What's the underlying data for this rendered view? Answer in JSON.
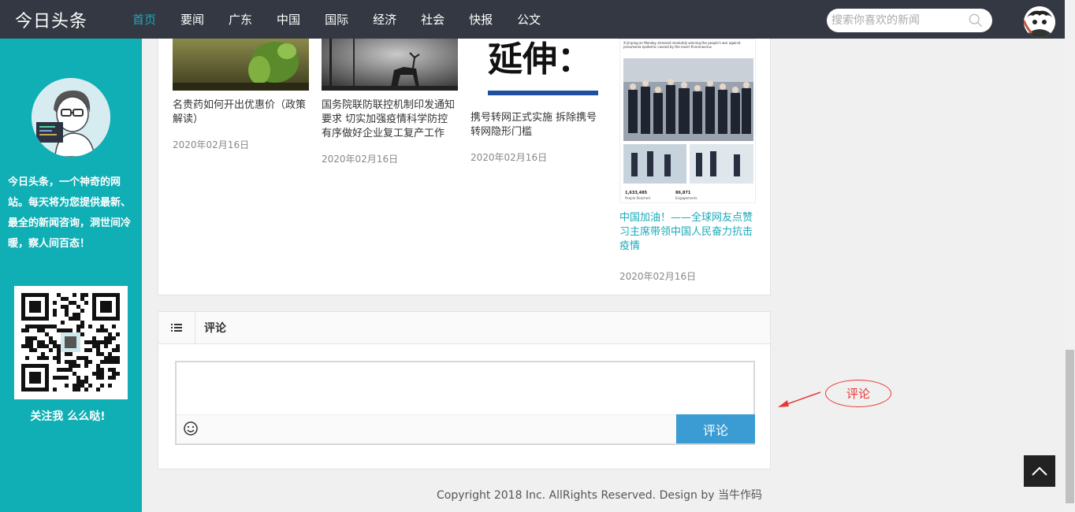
{
  "header": {
    "logo": "今日头条",
    "nav": [
      "首页",
      "要闻",
      "广东",
      "中国",
      "国际",
      "经济",
      "社会",
      "快报",
      "公文"
    ],
    "active_index": 0,
    "search_placeholder": "搜索你喜欢的新闻"
  },
  "sidebar": {
    "description": "今日头条，一个神奇的网站。每天将为您提供最新、最全的新闻咨询，洞世间冷暖，察人间百态！",
    "follow": "关注我 么么哒!"
  },
  "articles": [
    {
      "title": "名贵药如何开出优惠价（政策解读）",
      "date": "2020年02月16日"
    },
    {
      "title": "国务院联防联控机制印发通知要求 切实加强疫情科学防控 有序做好企业复工复产工作",
      "date": "2020年02月16日"
    },
    {
      "title": "携号转网正式实施 拆除携号转网隐形门槛",
      "date": "2020年02月16日",
      "image_text": "延伸："
    },
    {
      "title": "中国加油！——全球网友点赞习主席带领中国人民奋力抗击疫情",
      "date": "2020年02月16日",
      "image_caption": "Xi Jinping on Monday stressed resolutely winning the people's war against pneumonia epidemic caused by the novel #coronavirus",
      "stats": [
        {
          "value": "1,633,485",
          "label": "People Reached"
        },
        {
          "value": "86,871",
          "label": "Engagements"
        }
      ]
    }
  ],
  "comment": {
    "title": "评论",
    "submit_label": "评论"
  },
  "annotation": {
    "label": "评论"
  },
  "footer": {
    "copyright": "Copyright 2018 Inc. AllRights Reserved. Design by 当牛作码"
  },
  "colors": {
    "nav_bg": "#333842",
    "accent": "#1aaaba",
    "sidebar_bg": "#10aeb5",
    "button": "#3a9cd2",
    "annotation": "#e53935"
  }
}
